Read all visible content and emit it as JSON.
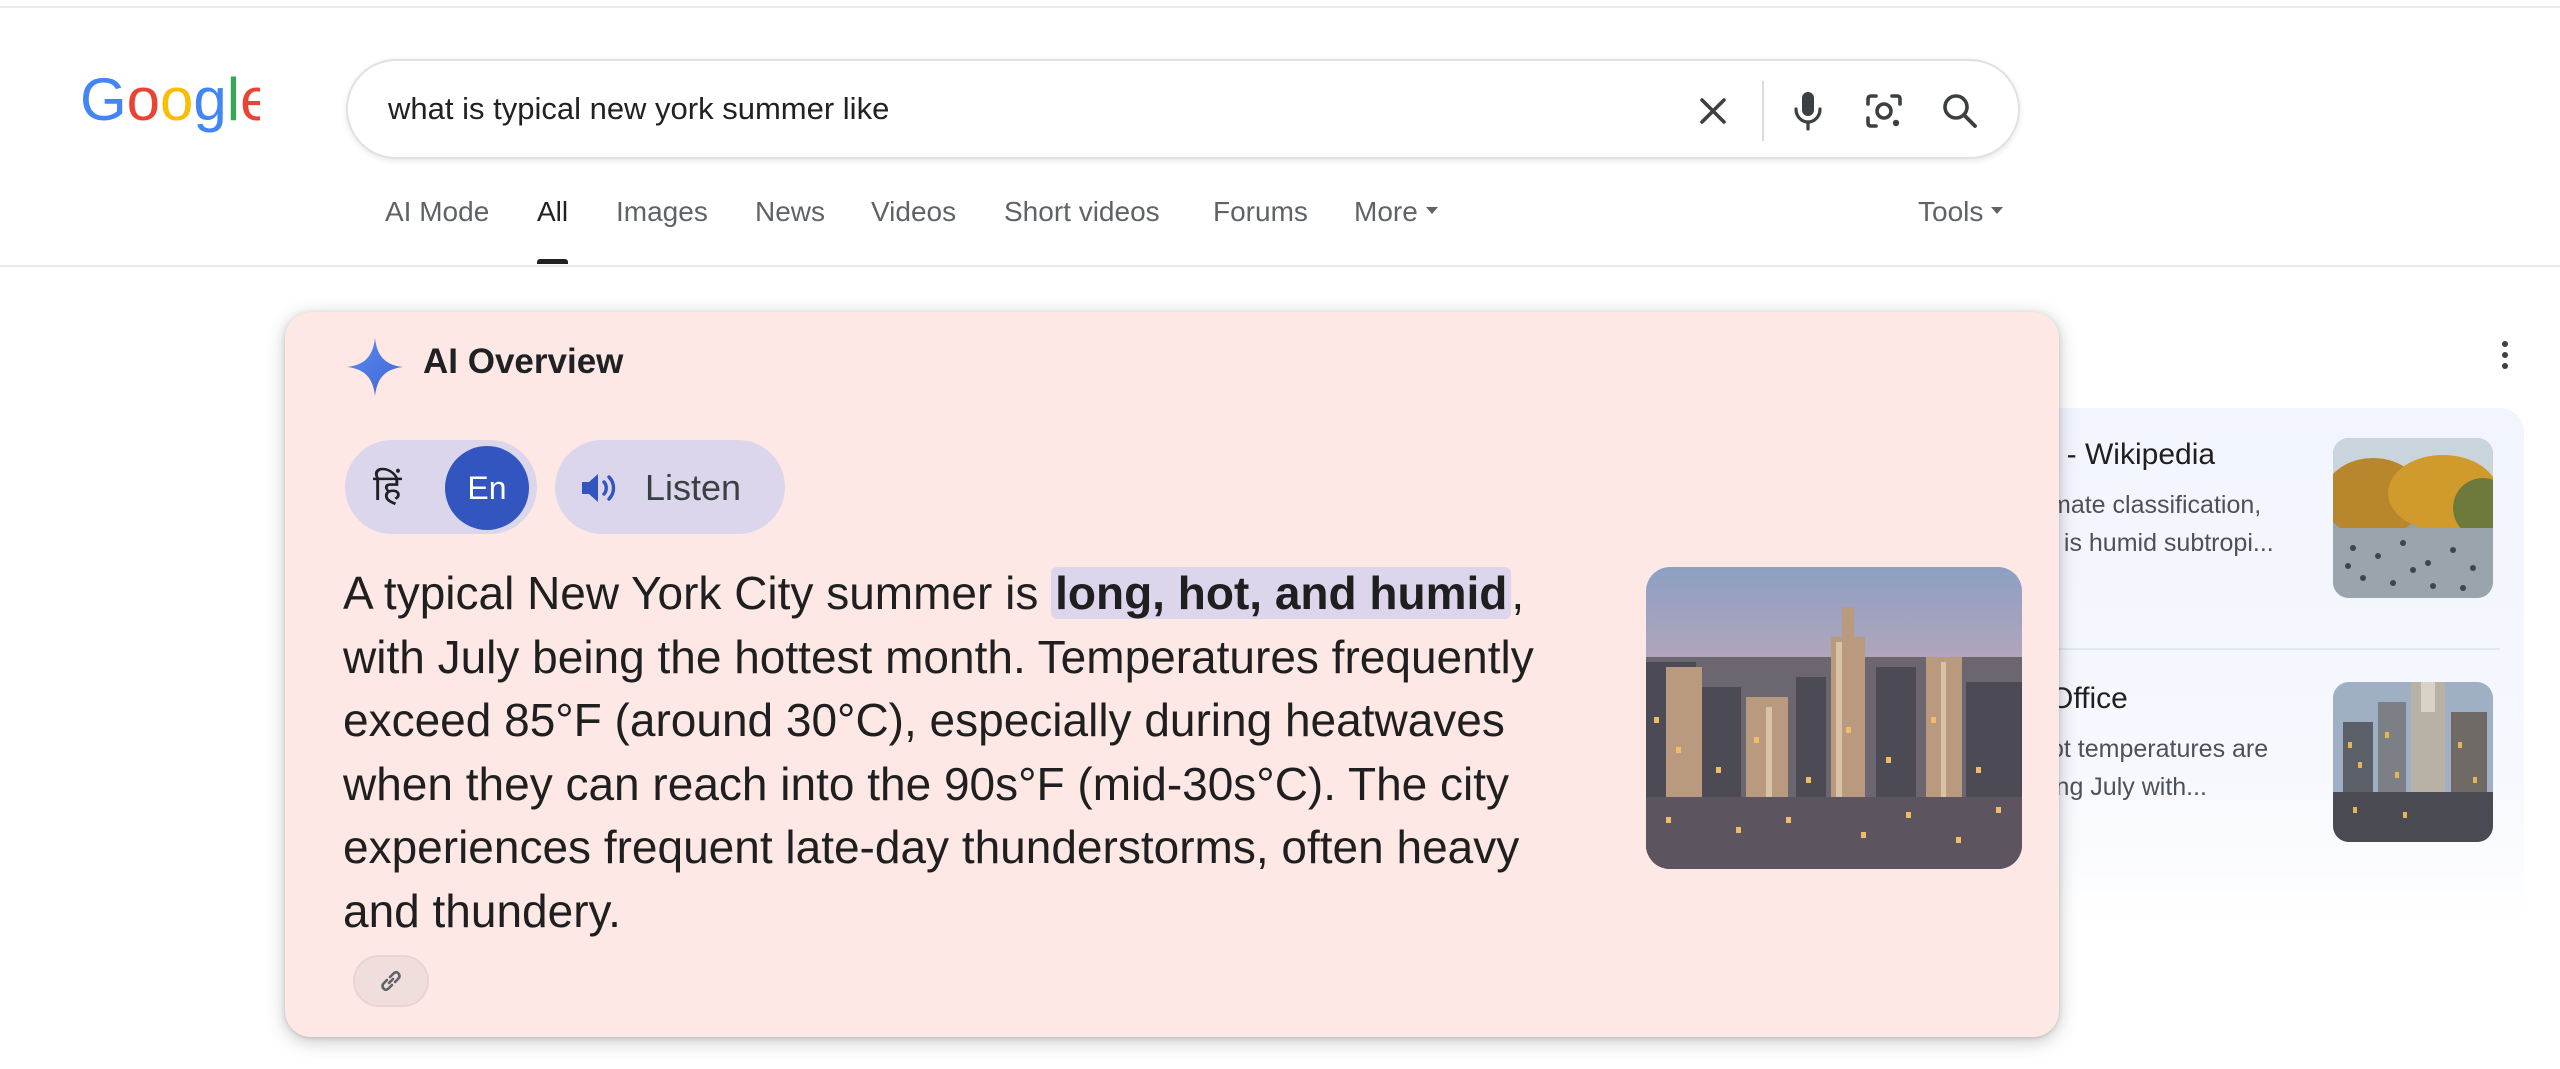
{
  "logo": {
    "text": "Google",
    "letter_colors": [
      "#4285F4",
      "#EA4335",
      "#FBBC05",
      "#4285F4",
      "#34A853",
      "#EA4335"
    ]
  },
  "search": {
    "query": "what is typical new york summer like",
    "icons": [
      "close-icon",
      "microphone-icon",
      "camera-lens-icon",
      "search-icon"
    ]
  },
  "tabs": [
    {
      "label": "AI Mode",
      "active": false
    },
    {
      "label": "All",
      "active": true
    },
    {
      "label": "Images",
      "active": false
    },
    {
      "label": "News",
      "active": false
    },
    {
      "label": "Videos",
      "active": false
    },
    {
      "label": "Short videos",
      "active": false
    },
    {
      "label": "Forums",
      "active": false
    },
    {
      "label": "More",
      "active": false,
      "dropdown": true
    }
  ],
  "tools": {
    "label": "Tools"
  },
  "ai_overview": {
    "title": "AI Overview",
    "lang_hi": "हिं",
    "lang_en": "En",
    "listen_label": "Listen",
    "text": {
      "line1_before": "A typical New York City summer is ",
      "line1_highlight": "long, hot, and humid",
      "line1_after": ",",
      "line2": "with July being the hottest month. Temperatures frequently",
      "line3": "exceed 85°F (around 30°C), especially during heatwaves",
      "line4": "when they can reach into the 90s°F (mid-30s°C). The city",
      "line5": "experiences frequent late-day thunderstorms, often heavy",
      "line6": "and thundery."
    },
    "image_icon": "city-skyline-image",
    "link_icon": "link-icon"
  },
  "sources": [
    {
      "title": "/ - Wikipedia",
      "snippet": [
        "mate classification,",
        "/ is humid subtropi..."
      ],
      "image_icon": "park-crowd-image"
    },
    {
      "title": "Office",
      "snippet": [
        "ot temperatures are",
        "ing July with..."
      ],
      "image_icon": "skyscraper-image"
    }
  ],
  "colors": {
    "ai_overview_bg": "#fde8e6",
    "highlight_bg": "#dcd5ec",
    "lang_en_bg": "#3255c0",
    "sparkle_blue": "#4c7be8",
    "sources_panel_bg": "#f2f5fe"
  }
}
